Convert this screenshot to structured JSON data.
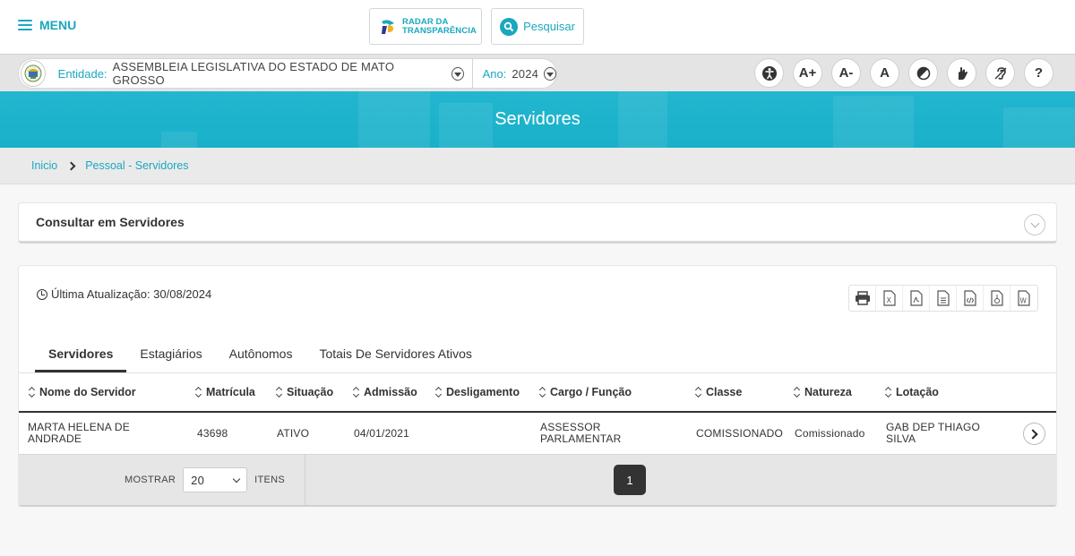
{
  "header": {
    "menu_label": "MENU",
    "radar_line1": "RADAR DA",
    "radar_line2": "TRANSPARÊNCIA",
    "search_label": "Pesquisar"
  },
  "entity_bar": {
    "entity_label": "Entidade:",
    "entity_value": "ASSEMBLEIA LEGISLATIVA DO ESTADO DE MATO GROSSO",
    "year_label": "Ano:",
    "year_value": "2024",
    "accessibility": [
      {
        "name": "accessibility-icon",
        "label": ""
      },
      {
        "name": "font-increase-button",
        "label": "A+"
      },
      {
        "name": "font-decrease-button",
        "label": "A-"
      },
      {
        "name": "font-reset-button",
        "label": "A"
      },
      {
        "name": "contrast-icon",
        "label": ""
      },
      {
        "name": "sign-language-icon",
        "label": ""
      },
      {
        "name": "hearing-icon",
        "label": ""
      },
      {
        "name": "help-button",
        "label": "?"
      }
    ]
  },
  "banner": {
    "title": "Servidores"
  },
  "breadcrumb": {
    "home": "Inicio",
    "current": "Pessoal - Servidores"
  },
  "consult": {
    "title": "Consultar em Servidores"
  },
  "main": {
    "last_update": "Última Atualização: 30/08/2024",
    "export_icons": [
      "print-icon",
      "excel-icon",
      "pdf-icon",
      "text-file-icon",
      "html-file-icon",
      "csv-file-icon",
      "word-file-icon"
    ],
    "tabs": [
      "Servidores",
      "Estagiários",
      "Autônomos",
      "Totais De Servidores Ativos"
    ],
    "active_tab": 0,
    "columns": [
      "Nome do Servidor",
      "Matrícula",
      "Situação",
      "Admissão",
      "Desligamento",
      "Cargo / Função",
      "Classe",
      "Natureza",
      "Lotação"
    ],
    "rows": [
      {
        "nome_l1": "MARTA HELENA DE",
        "nome_l2": "ANDRADE",
        "matricula": "43698",
        "situacao": "ATIVO",
        "admissao": "04/01/2021",
        "desligamento": "",
        "cargo_l1": "ASSESSOR",
        "cargo_l2": "PARLAMENTAR",
        "classe": "COMISSIONADO",
        "natureza": "Comissionado",
        "lotacao_l1": "GAB DEP THIAGO",
        "lotacao_l2": "SILVA"
      }
    ],
    "pager": {
      "show_label": "MOSTRAR",
      "page_size": "20",
      "items_label": "ITENS",
      "current_page": "1"
    }
  },
  "colors": {
    "accent": "#1aa8c0",
    "banner": "#1fb3cc",
    "dark": "#333333"
  }
}
